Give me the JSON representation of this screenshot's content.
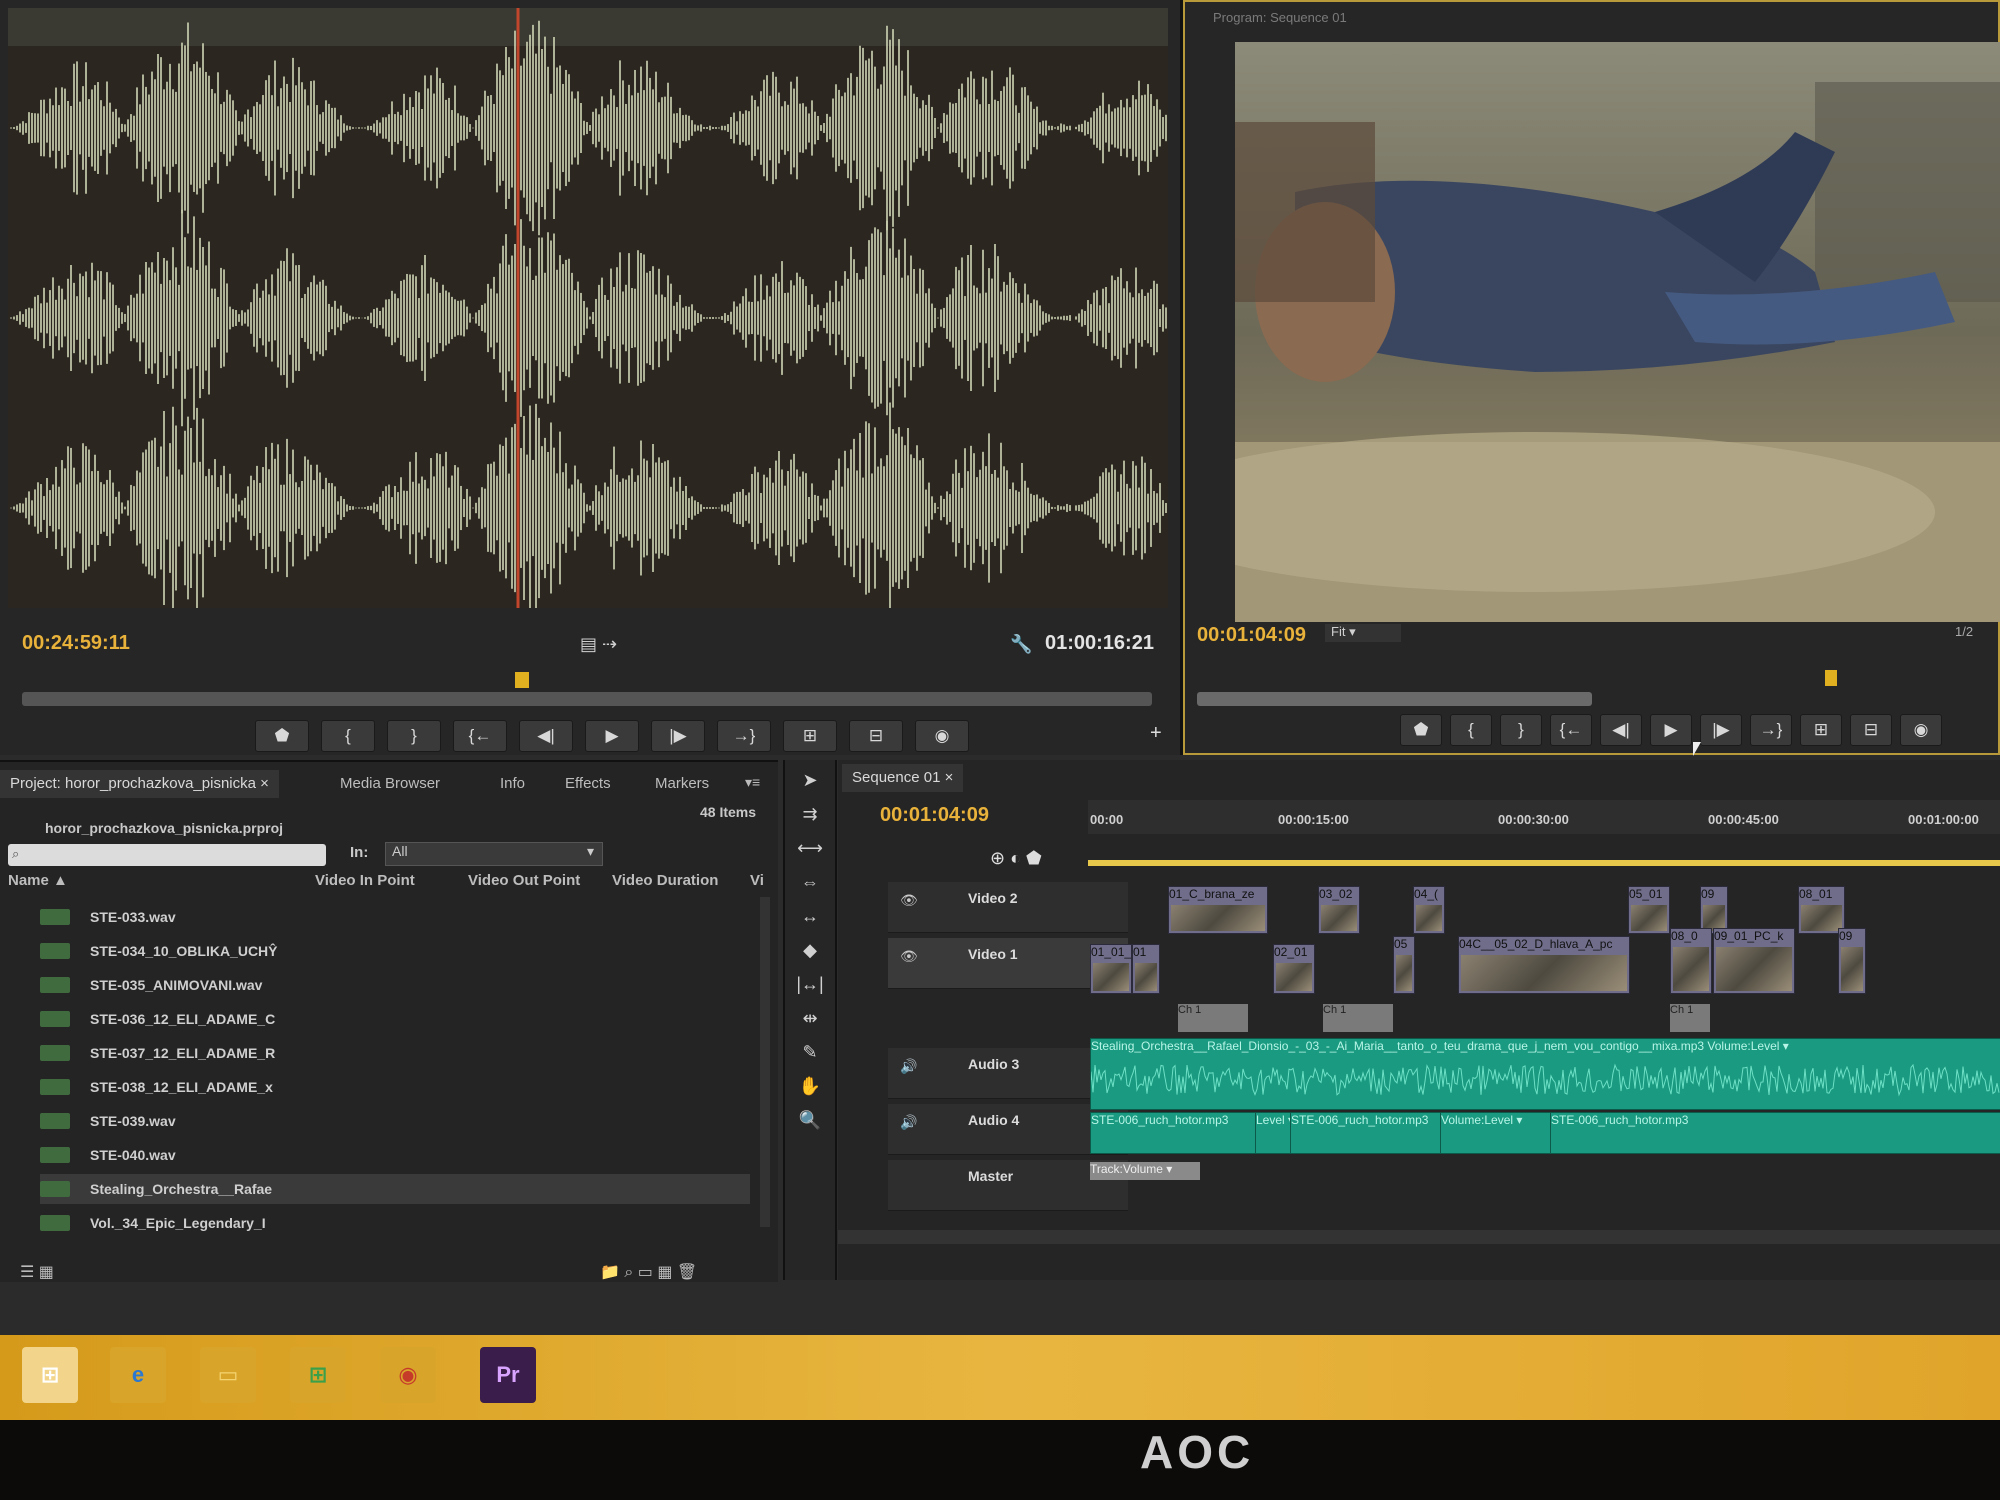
{
  "source_monitor": {
    "current_timecode": "00:24:59:11",
    "duration_timecode": "01:00:16:21"
  },
  "program_monitor": {
    "title": "Program: Sequence 01",
    "current_timecode": "00:01:04:09",
    "fit_label": "Fit",
    "resolution": "1/2"
  },
  "controls": [
    "marker",
    "in",
    "out",
    "go-in",
    "step-back",
    "play",
    "step-fwd",
    "go-out",
    "insert",
    "overwrite",
    "export-frame"
  ],
  "project_panel": {
    "tabs": [
      "Project: horor_prochazkova_pisnicka ×",
      "Media Browser",
      "Info",
      "Effects",
      "Markers"
    ],
    "project_file": "horor_prochazkova_pisnicka.prproj",
    "item_count": "48 Items",
    "in_label": "In:",
    "in_value": "All",
    "columns": [
      "Name",
      "Video In Point",
      "Video Out Point",
      "Video Duration",
      "Vi"
    ],
    "items": [
      "STE-033.wav",
      "STE-034_10_OBLIKA_UCHŶ",
      "STE-035_ANIMOVANI.wav",
      "STE-036_12_ELI_ADAME_C",
      "STE-037_12_ELI_ADAME_R",
      "STE-038_12_ELI_ADAME_x",
      "STE-039.wav",
      "STE-040.wav",
      "Stealing_Orchestra__Rafae",
      "Vol._34_Epic_Legendary_I"
    ]
  },
  "timeline": {
    "tab": "Sequence 01 ×",
    "current_timecode": "00:01:04:09",
    "ruler": [
      "00:00",
      "00:00:15:00",
      "00:00:30:00",
      "00:00:45:00",
      "00:01:00:00"
    ],
    "tracks": [
      "Video 2",
      "Video 1",
      "Audio 3",
      "Audio 4",
      "Master"
    ],
    "video2_clips": [
      "01_C_brana_ze",
      "03_02",
      "04_(",
      "05_01",
      "09",
      "08_01"
    ],
    "video1_clips": [
      "01_01_l",
      "01",
      "02_01",
      "05",
      "04C__05_02_D_hlava_A_pc",
      "08_0",
      "09_01_PC_k",
      "09"
    ],
    "audio_main": "Stealing_Orchestra__Rafael_Dionsio_-_03_-_Ai_Maria__tanto_o_teu_drama_que_j_nem_vou_contigo__mixa.mp3  Volume:Level ▾",
    "audio3_clips": [
      "STE-006_ruch_hotor.mp3",
      "Level ▾",
      "STE-006_ruch_hotor.mp3",
      "Volume:Level ▾",
      "STE-006_ruch_hotor.mp3"
    ],
    "audio4_label": "Track:Volume ▾",
    "ch_label": "Ch 1"
  },
  "taskbar": {
    "apps": [
      "start",
      "ie",
      "explorer",
      "store",
      "chrome",
      "premiere"
    ],
    "premiere_label": "Pr"
  },
  "monitor_brand": "AOC",
  "colors": {
    "accent": "#e9b23a",
    "audio_clip": "#1a9a80",
    "video_clip": "#6f6d8a",
    "taskbar": "#e3a830"
  }
}
